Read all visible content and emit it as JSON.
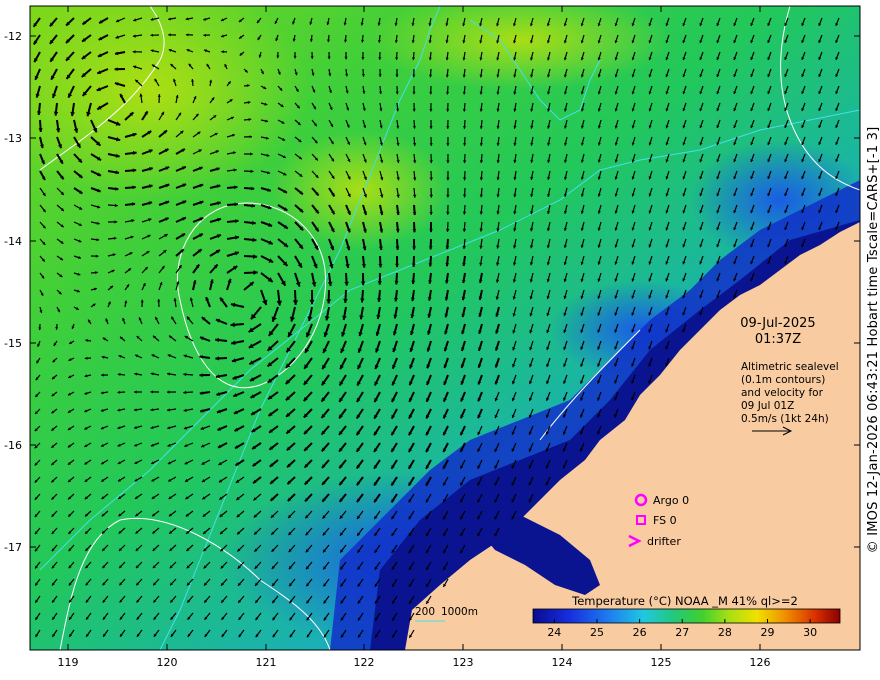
{
  "map": {
    "lat_ticks": [
      "-12",
      "-13",
      "-14",
      "-15",
      "-16",
      "-17"
    ],
    "lon_ticks": [
      "119",
      "120",
      "121",
      "122",
      "123",
      "124",
      "125",
      "126"
    ],
    "date": "09-Jul-2025",
    "time": "01:37Z",
    "note_lines": [
      "Altimetric sealevel",
      "(0.1m contours)",
      "and velocity for",
      "09 Jul 01Z",
      "0.5m/s (1kt 24h)"
    ],
    "legend": {
      "argo": "Argo 0",
      "fs": "FS 0",
      "drifter": "drifter"
    },
    "isobath_label_200": "200",
    "isobath_label_1000": "1000m",
    "colorbar": {
      "title": "Temperature (°C) NOAA _M 41% ql>=2",
      "ticks": [
        "24",
        "25",
        "26",
        "27",
        "28",
        "29",
        "30"
      ],
      "range": [
        23.5,
        30.7
      ]
    },
    "side_caption": "© IMOS 12-Jan-2026 06:43:21 Hobart time Tscale=CARS+[-1 3]",
    "colors": {
      "land": "#f8cba0",
      "isobath": "#44e0e8",
      "contour": "#ffffff",
      "legend_marker": "#ff00ff",
      "arrow": "#000000"
    },
    "icons": [
      "argo-circle-icon",
      "fs-square-icon",
      "drifter-chevron-icon",
      "scale-arrow-icon"
    ]
  }
}
